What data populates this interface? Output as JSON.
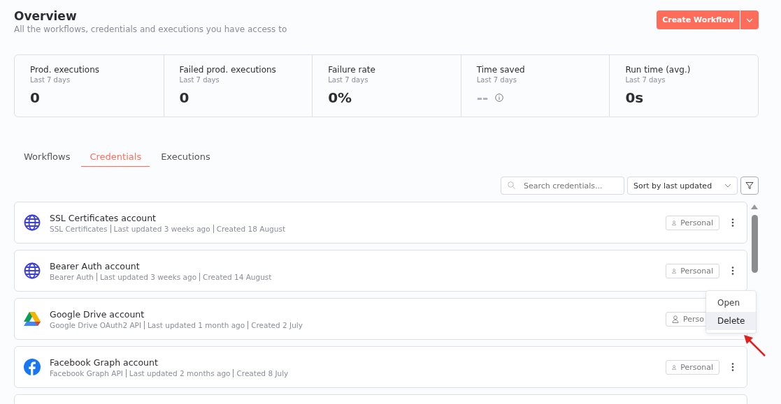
{
  "header": {
    "title": "Overview",
    "subtitle": "All the workflows, credentials and executions you have access to",
    "primary_button": "Create Workflow"
  },
  "stats": [
    {
      "label": "Prod. executions",
      "period": "Last 7 days",
      "value": "0",
      "muted": false
    },
    {
      "label": "Failed prod. executions",
      "period": "Last 7 days",
      "value": "0",
      "muted": false
    },
    {
      "label": "Failure rate",
      "period": "Last 7 days",
      "value": "0%",
      "muted": false
    },
    {
      "label": "Time saved",
      "period": "Last 7 days",
      "value": "--",
      "muted": true
    },
    {
      "label": "Run time (avg.)",
      "period": "Last 7 days",
      "value": "0s",
      "muted": false
    }
  ],
  "tabs": [
    {
      "label": "Workflows",
      "selected": false
    },
    {
      "label": "Credentials",
      "selected": true
    },
    {
      "label": "Executions",
      "selected": false
    }
  ],
  "search": {
    "placeholder": "Search credentials..."
  },
  "sort": {
    "value": "Sort by last updated"
  },
  "credentials": [
    {
      "kind": "globe",
      "name": "SSL Certificates account",
      "type": "SSL Certificates",
      "updated": "Last updated 3 weeks ago",
      "created": "Created 18 August",
      "owner": "Personal"
    },
    {
      "kind": "globe",
      "name": "Bearer Auth account",
      "type": "Bearer Auth",
      "updated": "Last updated 3 weeks ago",
      "created": "Created 14 August",
      "owner": "Personal"
    },
    {
      "kind": "drive",
      "name": "Google Drive account",
      "type": "Google Drive OAuth2 API",
      "updated": "Last updated 1 month ago",
      "created": "Created 2 July",
      "owner": "Perso"
    },
    {
      "kind": "facebook",
      "name": "Facebook Graph account",
      "type": "Facebook Graph API",
      "updated": "Last updated 2 months ago",
      "created": "Created 8 July",
      "owner": "Personal"
    }
  ],
  "menu": {
    "items": [
      {
        "label": "Open",
        "highlighted": false
      },
      {
        "label": "Delete",
        "highlighted": true
      }
    ]
  }
}
